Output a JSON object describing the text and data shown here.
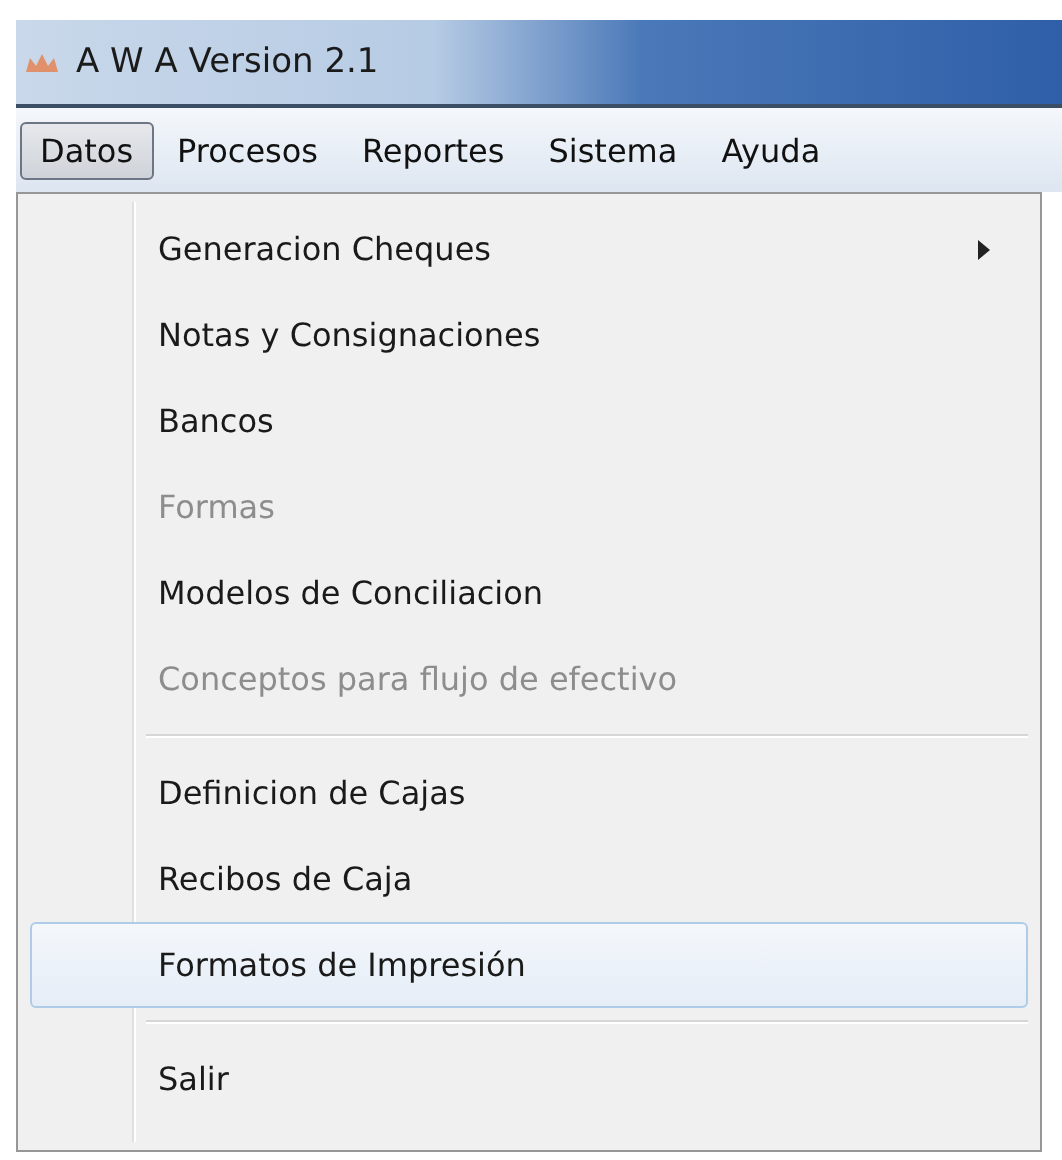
{
  "window": {
    "title": "A W A Version 2.1"
  },
  "menubar": [
    {
      "label": "Datos",
      "selected": true
    },
    {
      "label": "Procesos",
      "selected": false
    },
    {
      "label": "Reportes",
      "selected": false
    },
    {
      "label": "Sistema",
      "selected": false
    },
    {
      "label": "Ayuda",
      "selected": false
    }
  ],
  "menu": [
    {
      "kind": "item",
      "label": "Generacion Cheques",
      "disabled": false,
      "submenu": true,
      "selected": false
    },
    {
      "kind": "item",
      "label": "Notas y Consignaciones",
      "disabled": false,
      "submenu": false,
      "selected": false
    },
    {
      "kind": "item",
      "label": "Bancos",
      "disabled": false,
      "submenu": false,
      "selected": false
    },
    {
      "kind": "item",
      "label": "Formas",
      "disabled": true,
      "submenu": false,
      "selected": false
    },
    {
      "kind": "item",
      "label": "Modelos de Conciliacion",
      "disabled": false,
      "submenu": false,
      "selected": false
    },
    {
      "kind": "item",
      "label": "Conceptos para flujo de efectivo",
      "disabled": true,
      "submenu": false,
      "selected": false
    },
    {
      "kind": "separator"
    },
    {
      "kind": "item",
      "label": "Definicion de Cajas",
      "disabled": false,
      "submenu": false,
      "selected": false
    },
    {
      "kind": "item",
      "label": "Recibos de Caja",
      "disabled": false,
      "submenu": false,
      "selected": false
    },
    {
      "kind": "item",
      "label": "Formatos de Impresión",
      "disabled": false,
      "submenu": false,
      "selected": true
    },
    {
      "kind": "separator"
    },
    {
      "kind": "item",
      "label": "Salir",
      "disabled": false,
      "submenu": false,
      "selected": false
    }
  ]
}
